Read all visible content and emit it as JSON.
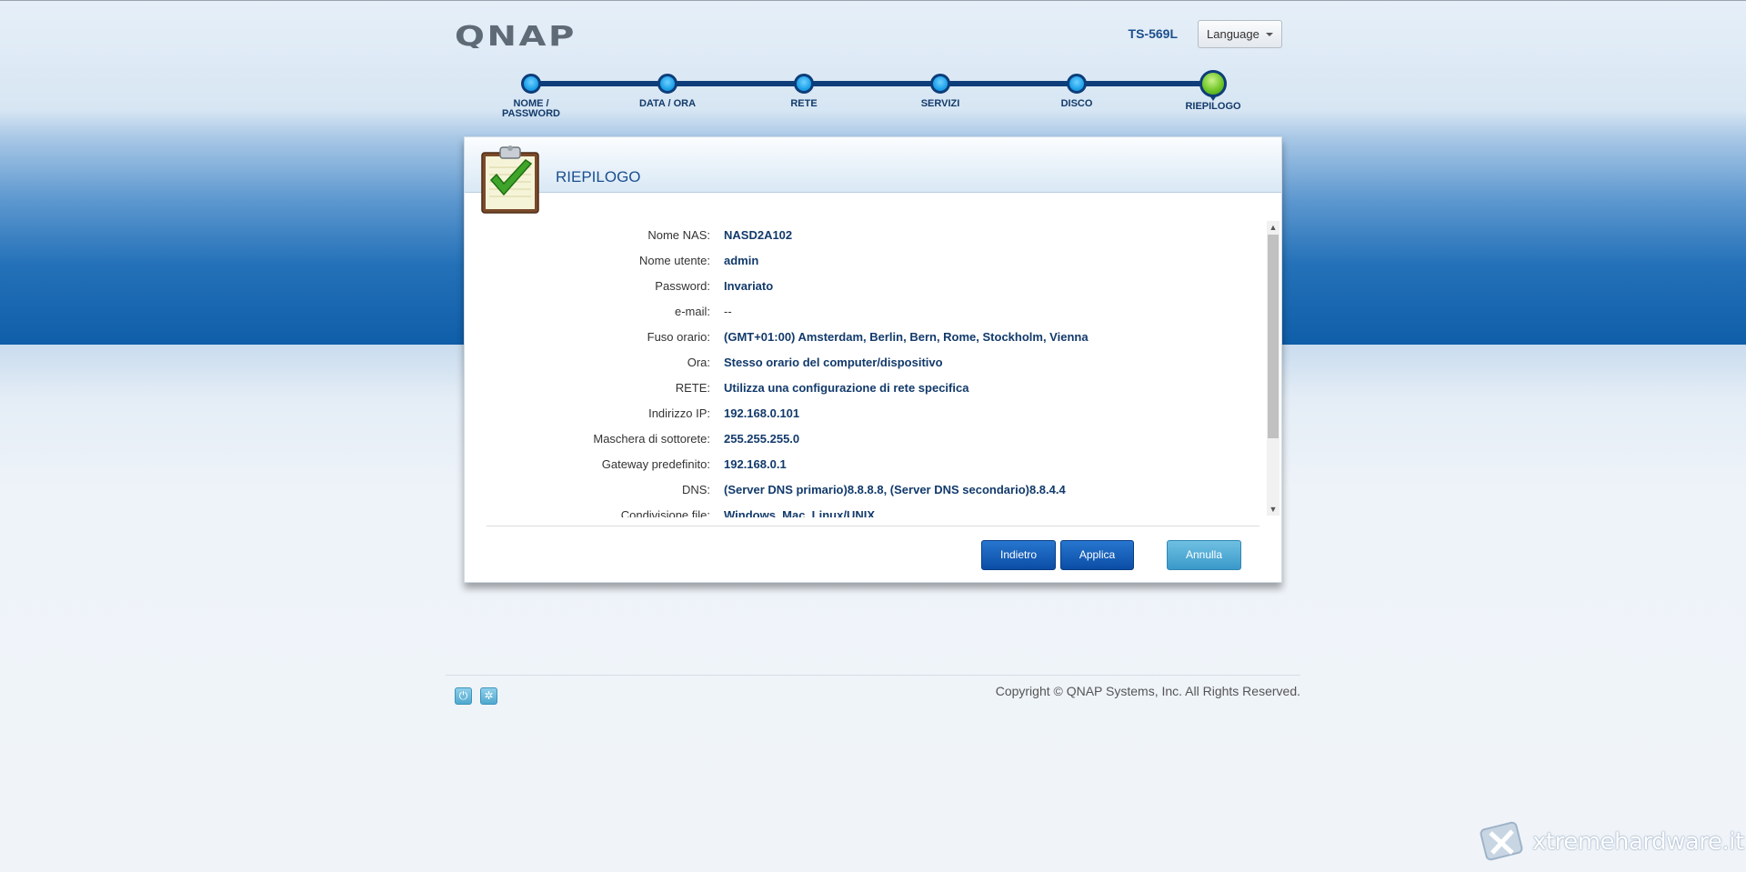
{
  "header": {
    "logo_text": "QNAP",
    "model": "TS-569L",
    "language_label": "Language"
  },
  "steps": [
    {
      "label_line1": "NOME /",
      "label_line2": "PASSWORD",
      "active": false
    },
    {
      "label_line1": "DATA / ORA",
      "label_line2": "",
      "active": false
    },
    {
      "label_line1": "RETE",
      "label_line2": "",
      "active": false
    },
    {
      "label_line1": "SERVIZI",
      "label_line2": "",
      "active": false
    },
    {
      "label_line1": "DISCO",
      "label_line2": "",
      "active": false
    },
    {
      "label_line1": "RIEPILOGO",
      "label_line2": "",
      "active": true
    }
  ],
  "panel": {
    "title": "RIEPILOGO",
    "rows": [
      {
        "key": "Nome NAS:",
        "value": "NASD2A102"
      },
      {
        "key": "Nome utente:",
        "value": "admin"
      },
      {
        "key": "Password:",
        "value": "Invariato"
      },
      {
        "key": "e-mail:",
        "value": "--"
      },
      {
        "key": "Fuso orario:",
        "value": "(GMT+01:00) Amsterdam, Berlin, Bern, Rome, Stockholm, Vienna"
      },
      {
        "key": "Ora:",
        "value": "Stesso orario del computer/dispositivo"
      },
      {
        "key": "RETE:",
        "value": "Utilizza una configurazione di rete specifica"
      },
      {
        "key": "Indirizzo IP:",
        "value": "192.168.0.101"
      },
      {
        "key": "Maschera di sottorete:",
        "value": "255.255.255.0"
      },
      {
        "key": "Gateway predefinito:",
        "value": "192.168.0.1"
      },
      {
        "key": "DNS:",
        "value": "(Server DNS primario)8.8.8.8, (Server DNS secondario)8.8.4.4"
      },
      {
        "key": "Condivisione file:",
        "value": "Windows. Mac. Linux/UNIX"
      }
    ],
    "buttons": {
      "back": "Indietro",
      "apply": "Applica",
      "cancel": "Annulla"
    }
  },
  "footer": {
    "copyright": "Copyright © QNAP Systems, Inc. All Rights Reserved."
  },
  "watermark": {
    "text": "xtremehardware.it"
  },
  "colors": {
    "accent": "#1a4f91",
    "step_line": "#0e3d7a",
    "active_step": "#72c72a",
    "button_dark": "#0b4da6",
    "button_light": "#3a99c9"
  }
}
